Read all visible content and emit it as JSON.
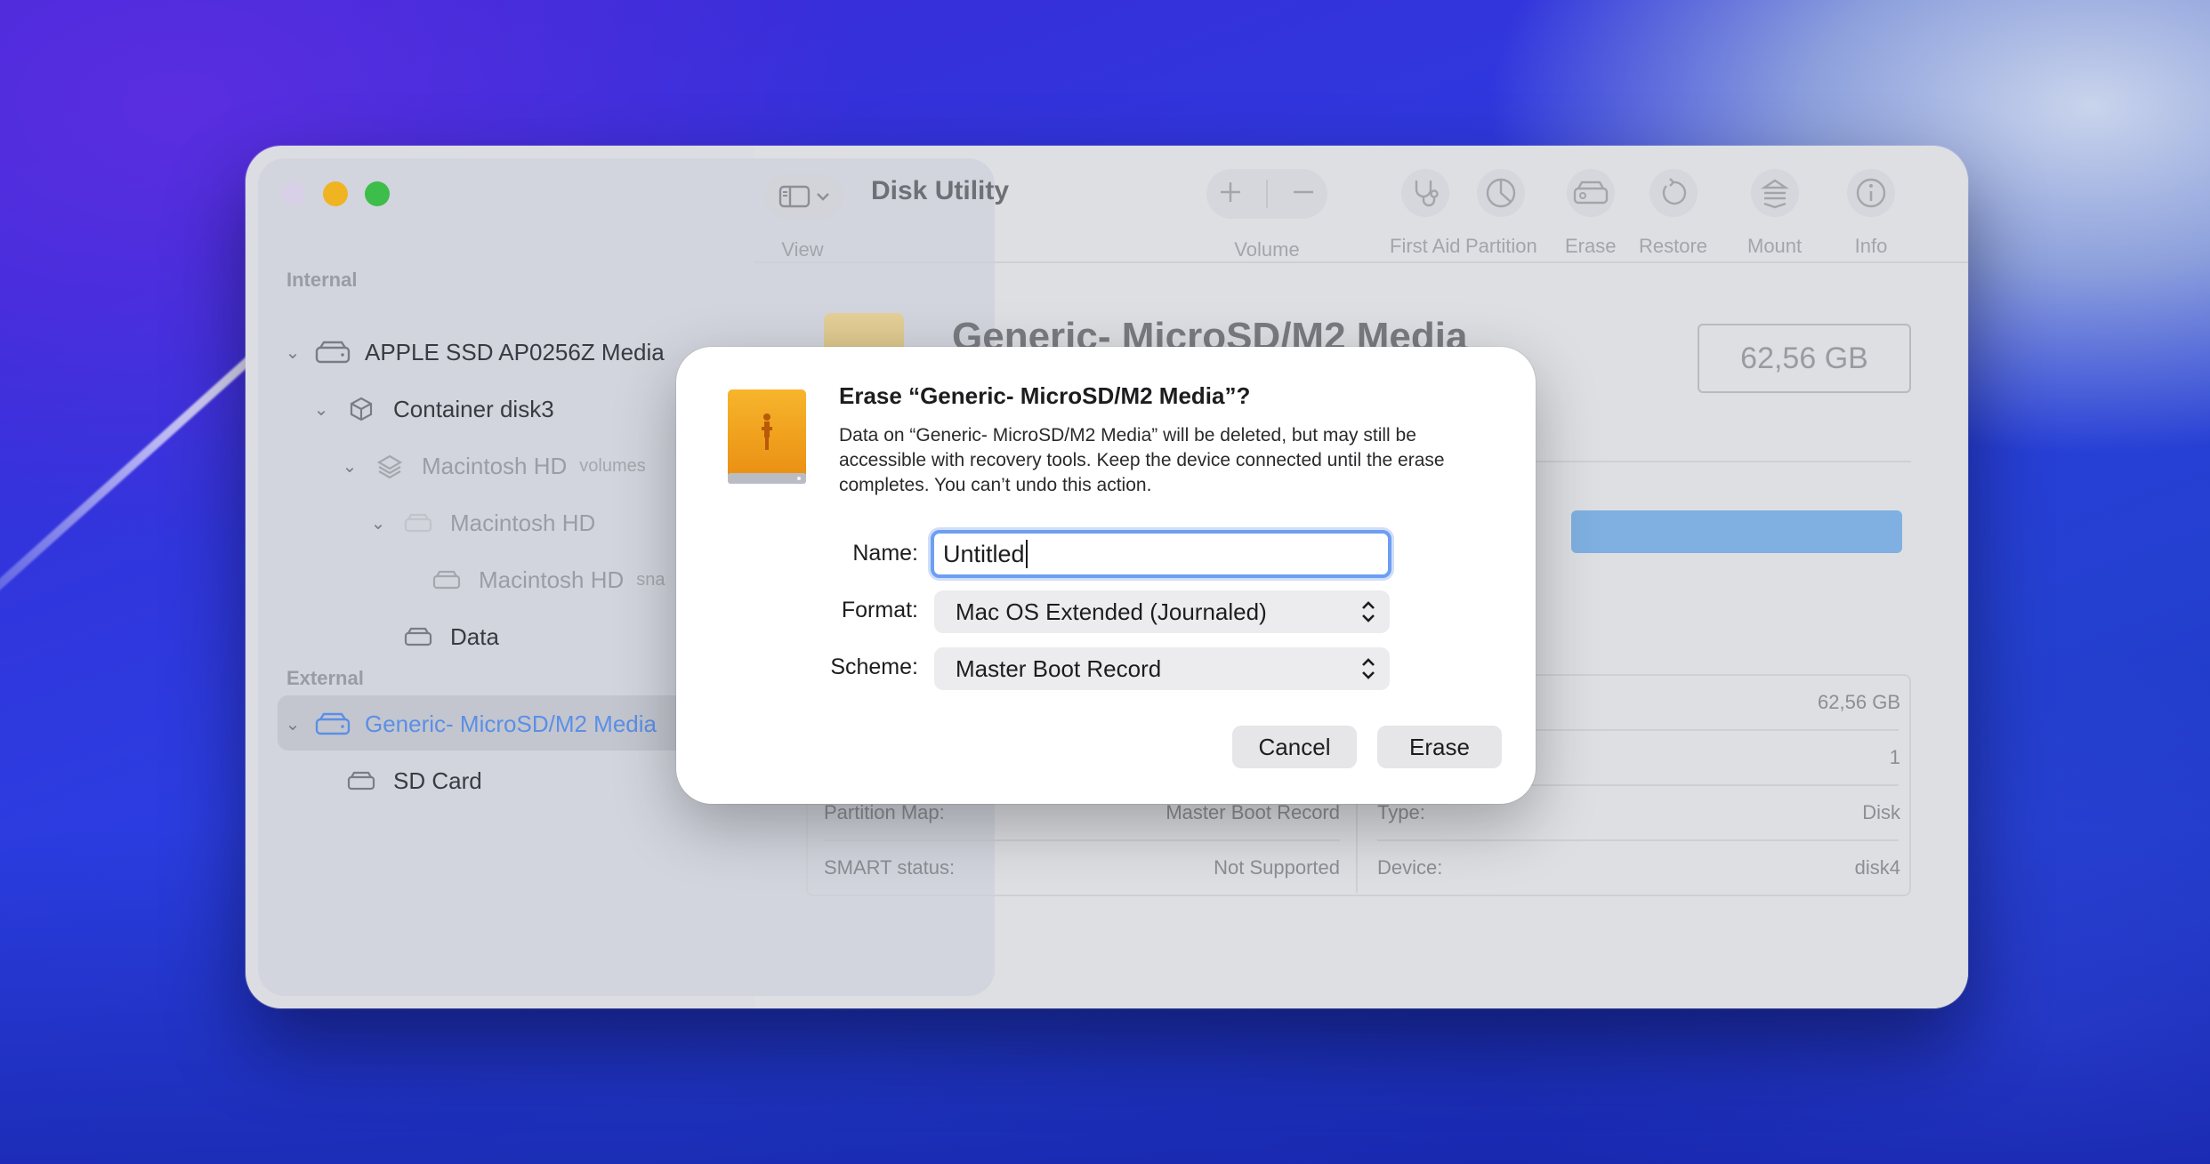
{
  "window": {
    "app_title": "Disk Utility",
    "toolbar": {
      "view_label": "View",
      "volume_label": "Volume",
      "first_aid_label": "First Aid",
      "partition_label": "Partition",
      "erase_label": "Erase",
      "restore_label": "Restore",
      "mount_label": "Mount",
      "info_label": "Info"
    },
    "sidebar": {
      "internal_label": "Internal",
      "external_label": "External",
      "items": [
        {
          "label": "APPLE SSD AP0256Z Media"
        },
        {
          "label": "Container disk3"
        },
        {
          "label": "Macintosh HD",
          "sub": "volumes"
        },
        {
          "label": "Macintosh HD"
        },
        {
          "label": "Macintosh HD",
          "sub": "sna"
        },
        {
          "label": "Data"
        },
        {
          "label": "Generic- MicroSD/M2 Media"
        },
        {
          "label": "SD Card"
        }
      ]
    },
    "main": {
      "disk_title": "Generic- MicroSD/M2 Media",
      "capacity": "62,56 GB",
      "info": {
        "capacity_value": "62,56 GB",
        "child_count_value": "1",
        "partition_map_label": "Partition Map:",
        "partition_map_value": "Master Boot Record",
        "type_label": "Type:",
        "type_value": "Disk",
        "smart_label": "SMART status:",
        "smart_value": "Not Supported",
        "device_label": "Device:",
        "device_value": "disk4"
      }
    }
  },
  "dialog": {
    "title": "Erase “Generic- MicroSD/M2 Media”?",
    "message": "Data on “Generic- MicroSD/M2 Media” will be deleted, but may still be accessible with recovery tools. Keep the device connected until the erase completes. You can’t undo this action.",
    "name_label": "Name:",
    "name_value": "Untitled",
    "format_label": "Format:",
    "format_value": "Mac OS Extended (Journaled)",
    "scheme_label": "Scheme:",
    "scheme_value": "Master Boot Record",
    "cancel_label": "Cancel",
    "erase_label": "Erase"
  },
  "colors": {
    "accent": "#6d9ef3",
    "selection_text": "#5b8fe6",
    "drive_orange": "#f0a020"
  }
}
